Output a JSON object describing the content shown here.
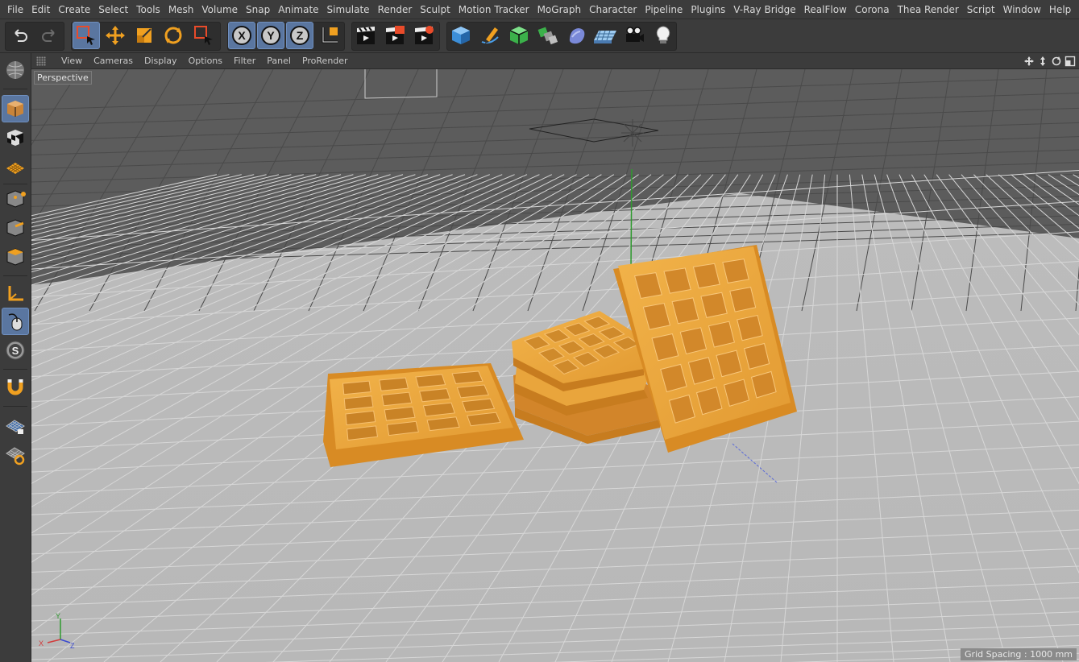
{
  "menubar": {
    "items": [
      "File",
      "Edit",
      "Create",
      "Select",
      "Tools",
      "Mesh",
      "Volume",
      "Snap",
      "Animate",
      "Simulate",
      "Render",
      "Sculpt",
      "Motion Tracker",
      "MoGraph",
      "Character",
      "Pipeline",
      "Plugins",
      "V-Ray Bridge",
      "RealFlow",
      "Corona",
      "Thea Render",
      "Script",
      "Window",
      "Help"
    ]
  },
  "toolbar": {
    "undo_icon": "undo-icon",
    "redo_icon": "redo-icon",
    "axis_x": "X",
    "axis_y": "Y",
    "axis_z": "Z"
  },
  "left_tools": {
    "snap_label": "S"
  },
  "viewport_menu": {
    "items": [
      "View",
      "Cameras",
      "Display",
      "Options",
      "Filter",
      "Panel",
      "ProRender"
    ]
  },
  "viewport": {
    "title": "Perspective",
    "grid_spacing": "Grid Spacing : 1000 mm",
    "axis_x": "X",
    "axis_y": "Y",
    "axis_z": "Z"
  },
  "colors": {
    "accent": "#5a76a0",
    "orange": "#f0a020",
    "waffle": "#e9a53c"
  }
}
